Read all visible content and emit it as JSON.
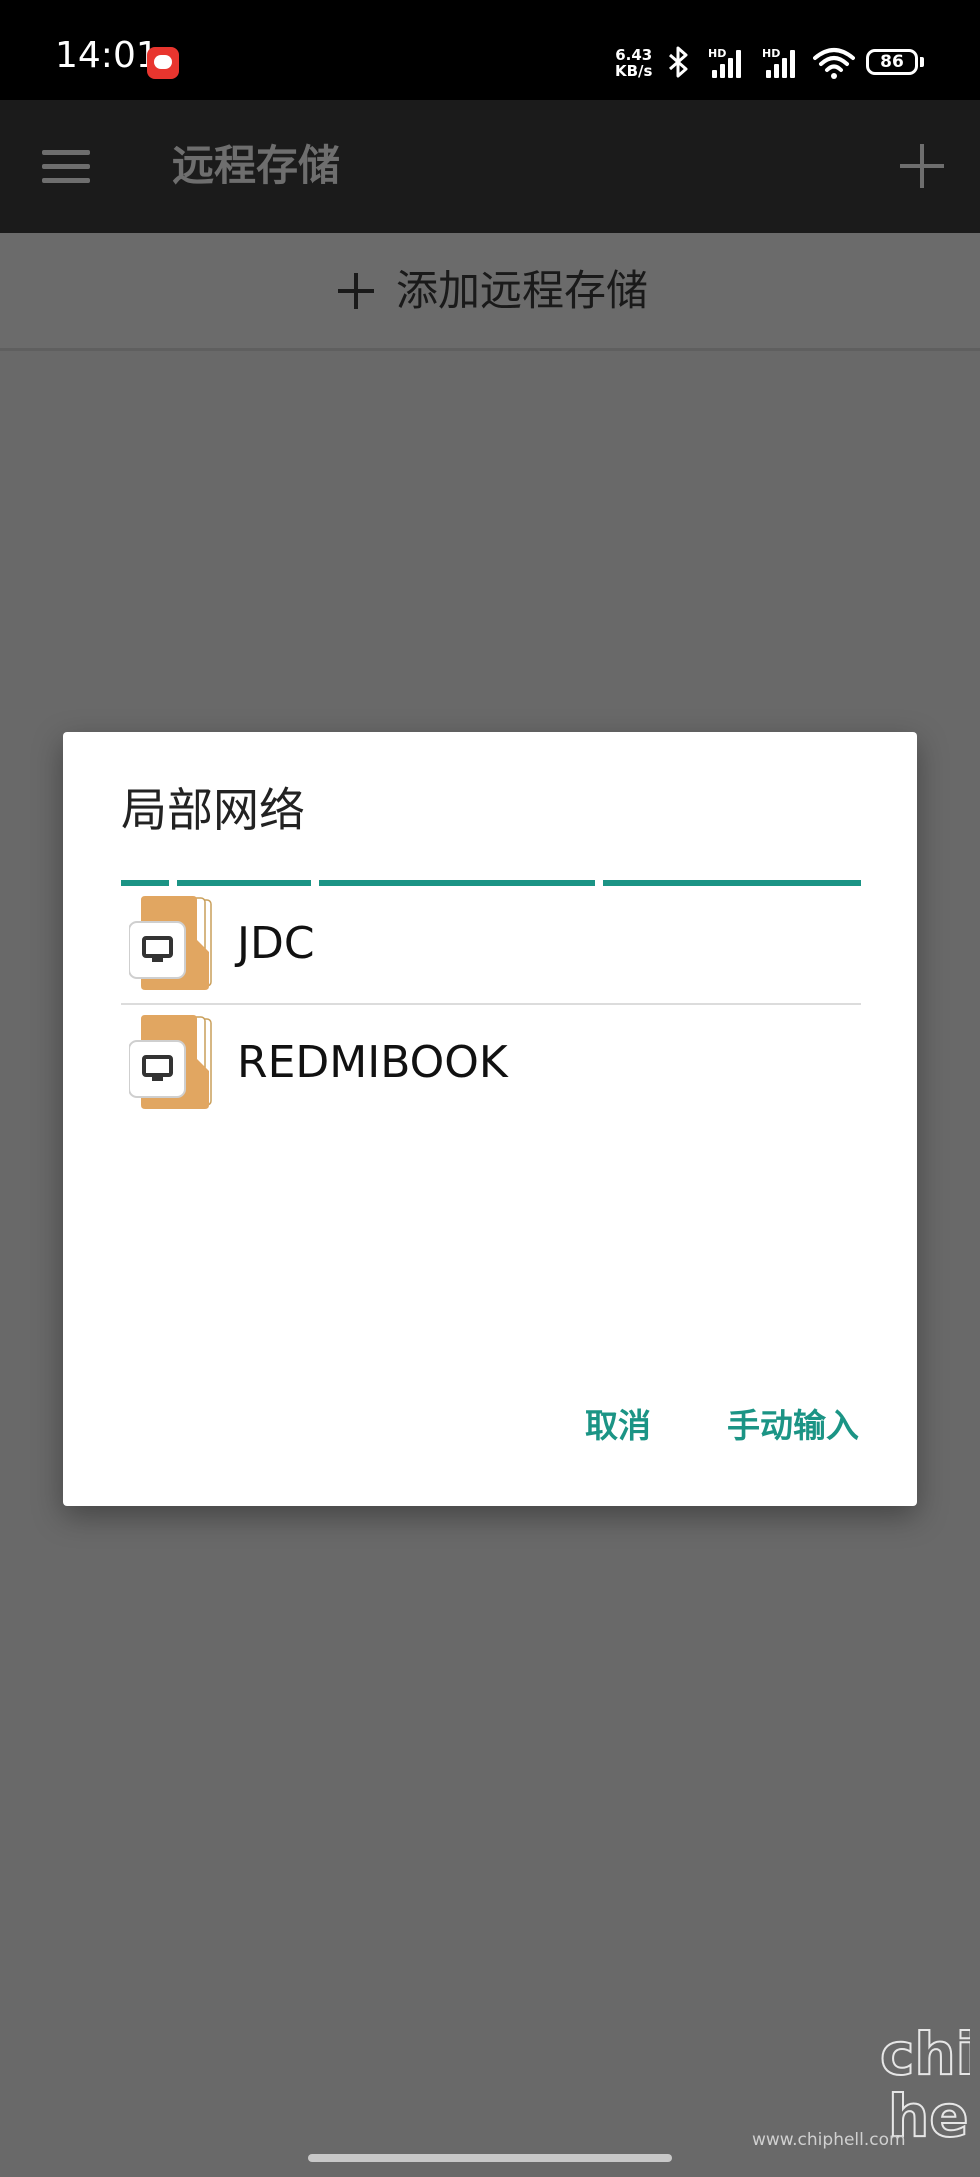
{
  "status_bar": {
    "time": "14:01",
    "net_speed_value": "6.43",
    "net_speed_unit": "KB/s",
    "signal_1_label": "HD",
    "signal_2_label": "HD",
    "battery_level": "86"
  },
  "app_bar": {
    "title": "远程存储"
  },
  "add_storage": {
    "label": "添加远程存储"
  },
  "dialog": {
    "title": "局部网络",
    "devices": [
      {
        "name": "JDC",
        "icon": "network-computer-folder-icon"
      },
      {
        "name": "REDMIBOOK",
        "icon": "network-computer-folder-icon"
      }
    ],
    "cancel_label": "取消",
    "manual_label": "手动输入",
    "accent_color": "#1b9485"
  },
  "watermark": {
    "site": "www.chiphell.com",
    "logo_text": "chip hell"
  }
}
